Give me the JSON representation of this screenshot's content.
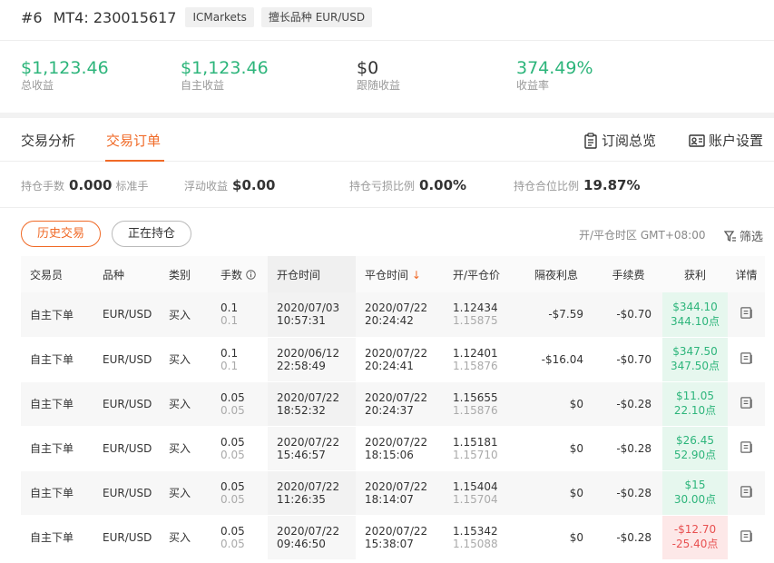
{
  "header": {
    "rank": "#6",
    "account": "MT4: 230015617",
    "broker_tag": "ICMarkets",
    "specialty_tag": "擅长品种 EUR/USD"
  },
  "stats": [
    {
      "value": "$1,123.46",
      "label": "总收益"
    },
    {
      "value": "$1,123.46",
      "label": "自主收益"
    },
    {
      "value": "$0",
      "label": "跟随收益"
    },
    {
      "value": "374.49%",
      "label": "收益率"
    }
  ],
  "tabs": {
    "analysis": "交易分析",
    "orders": "交易订单",
    "subscription": "订阅总览",
    "settings": "账户设置"
  },
  "positions": [
    {
      "key": "持仓手数",
      "value": "0.000",
      "unit": "标准手"
    },
    {
      "key": "浮动收益",
      "value": "$0.00",
      "unit": ""
    },
    {
      "key": "持仓亏损比例",
      "value": "0.00%",
      "unit": ""
    },
    {
      "key": "持仓合位比例",
      "value": "19.87%",
      "unit": ""
    }
  ],
  "buttons": {
    "history": "历史交易",
    "holding": "正在持仓"
  },
  "timezone": "开/平仓时区 GMT+08:00",
  "filter_label": "筛选",
  "columns": {
    "trader": "交易员",
    "symbol": "品种",
    "type": "类别",
    "lots": "手数",
    "open_time": "开仓时间",
    "close_time": "平仓时间",
    "price": "开/平仓价",
    "swap": "隔夜利息",
    "fee": "手续费",
    "profit": "获利",
    "detail": "详情"
  },
  "rows": [
    {
      "trader": "自主下单",
      "symbol": "EUR/USD",
      "type": "买入",
      "lots": "0.1",
      "lots2": "0.1",
      "open_date": "2020/07/03",
      "open_time": "10:57:31",
      "close_date": "2020/07/22",
      "close_time": "20:24:42",
      "open_price": "1.12434",
      "close_price": "1.15875",
      "swap": "-$7.59",
      "fee": "-$0.70",
      "profit": "$344.10",
      "points": "344.10点",
      "sign": "pos"
    },
    {
      "trader": "自主下单",
      "symbol": "EUR/USD",
      "type": "买入",
      "lots": "0.1",
      "lots2": "0.1",
      "open_date": "2020/06/12",
      "open_time": "22:58:49",
      "close_date": "2020/07/22",
      "close_time": "20:24:41",
      "open_price": "1.12401",
      "close_price": "1.15876",
      "swap": "-$16.04",
      "fee": "-$0.70",
      "profit": "$347.50",
      "points": "347.50点",
      "sign": "pos"
    },
    {
      "trader": "自主下单",
      "symbol": "EUR/USD",
      "type": "买入",
      "lots": "0.05",
      "lots2": "0.05",
      "open_date": "2020/07/22",
      "open_time": "18:52:32",
      "close_date": "2020/07/22",
      "close_time": "20:24:37",
      "open_price": "1.15655",
      "close_price": "1.15876",
      "swap": "$0",
      "fee": "-$0.28",
      "profit": "$11.05",
      "points": "22.10点",
      "sign": "pos"
    },
    {
      "trader": "自主下单",
      "symbol": "EUR/USD",
      "type": "买入",
      "lots": "0.05",
      "lots2": "0.05",
      "open_date": "2020/07/22",
      "open_time": "15:46:57",
      "close_date": "2020/07/22",
      "close_time": "18:15:06",
      "open_price": "1.15181",
      "close_price": "1.15710",
      "swap": "$0",
      "fee": "-$0.28",
      "profit": "$26.45",
      "points": "52.90点",
      "sign": "pos"
    },
    {
      "trader": "自主下单",
      "symbol": "EUR/USD",
      "type": "买入",
      "lots": "0.05",
      "lots2": "0.05",
      "open_date": "2020/07/22",
      "open_time": "11:26:35",
      "close_date": "2020/07/22",
      "close_time": "18:14:07",
      "open_price": "1.15404",
      "close_price": "1.15704",
      "swap": "$0",
      "fee": "-$0.28",
      "profit": "$15",
      "points": "30.00点",
      "sign": "pos"
    },
    {
      "trader": "自主下单",
      "symbol": "EUR/USD",
      "type": "买入",
      "lots": "0.05",
      "lots2": "0.05",
      "open_date": "2020/07/22",
      "open_time": "09:46:50",
      "close_date": "2020/07/22",
      "close_time": "15:38:07",
      "open_price": "1.15342",
      "close_price": "1.15088",
      "swap": "$0",
      "fee": "-$0.28",
      "profit": "-$12.70",
      "points": "-25.40点",
      "sign": "neg"
    }
  ]
}
